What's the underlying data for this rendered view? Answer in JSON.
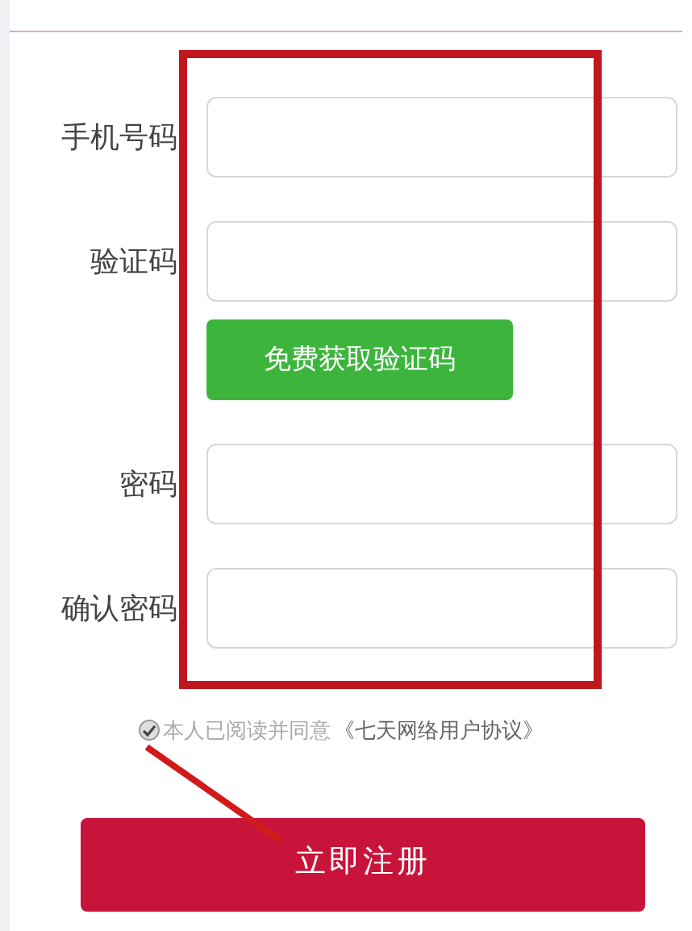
{
  "form": {
    "rows": [
      {
        "kind": "input",
        "label": "手机号码"
      },
      {
        "kind": "input",
        "label": "验证码"
      },
      {
        "kind": "button",
        "text": "免费获取验证码"
      },
      {
        "kind": "input",
        "label": "密码"
      },
      {
        "kind": "input",
        "label": "确认密码"
      }
    ],
    "agreement": {
      "checked": true,
      "text": "本人已阅读并同意",
      "link": "《七天网络用户协议》"
    },
    "submit": "立即注册"
  }
}
